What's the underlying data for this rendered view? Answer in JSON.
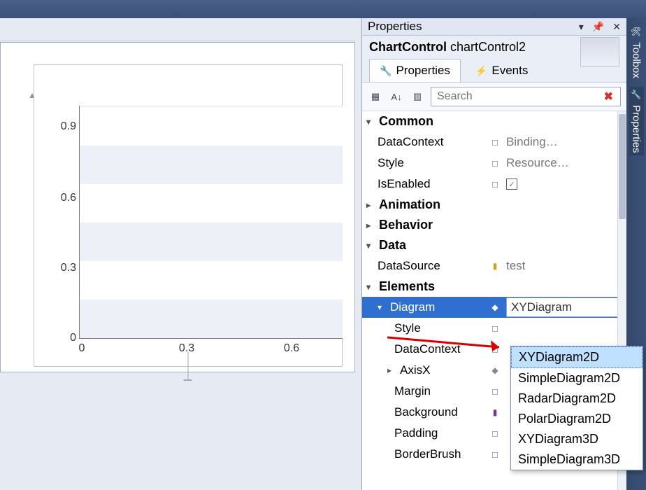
{
  "sidebar_tabs": {
    "toolbox": "Toolbox",
    "properties": "Properties"
  },
  "properties": {
    "panel_title": "Properties",
    "obj_type": "ChartControl",
    "obj_name": "chartControl2",
    "tab_props": "Properties",
    "tab_events": "Events",
    "search_placeholder": "Search",
    "cat_common": "Common",
    "cat_animation": "Animation",
    "cat_behavior": "Behavior",
    "cat_data": "Data",
    "cat_elements": "Elements",
    "rows": {
      "datacontext": {
        "label": "DataContext",
        "value": "Binding…"
      },
      "style_common": {
        "label": "Style",
        "value": "Resource…"
      },
      "isenabled": {
        "label": "IsEnabled",
        "checked": true
      },
      "datasource": {
        "label": "DataSource",
        "value": "test"
      },
      "diagram": {
        "label": "Diagram",
        "value": "XYDiagram"
      },
      "style_elem": {
        "label": "Style"
      },
      "datacontext_elem": {
        "label": "DataContext"
      },
      "axisx": {
        "label": "AxisX"
      },
      "margin": {
        "label": "Margin"
      },
      "background": {
        "label": "Background"
      },
      "padding": {
        "label": "Padding"
      },
      "borderbrush": {
        "label": "BorderBrush"
      }
    },
    "dropdown": {
      "items": [
        "XYDiagram2D",
        "SimpleDiagram2D",
        "RadarDiagram2D",
        "PolarDiagram2D",
        "XYDiagram3D",
        "SimpleDiagram3D"
      ],
      "highlight_index": 0
    }
  },
  "chart_data": {
    "type": "line",
    "title": "",
    "xlabel": "",
    "ylabel": "",
    "x_ticks": [
      0,
      0.3,
      0.6
    ],
    "y_ticks": [
      0,
      0.3,
      0.6,
      0.9
    ],
    "xlim": [
      0,
      1
    ],
    "ylim": [
      0,
      1
    ],
    "series": []
  }
}
